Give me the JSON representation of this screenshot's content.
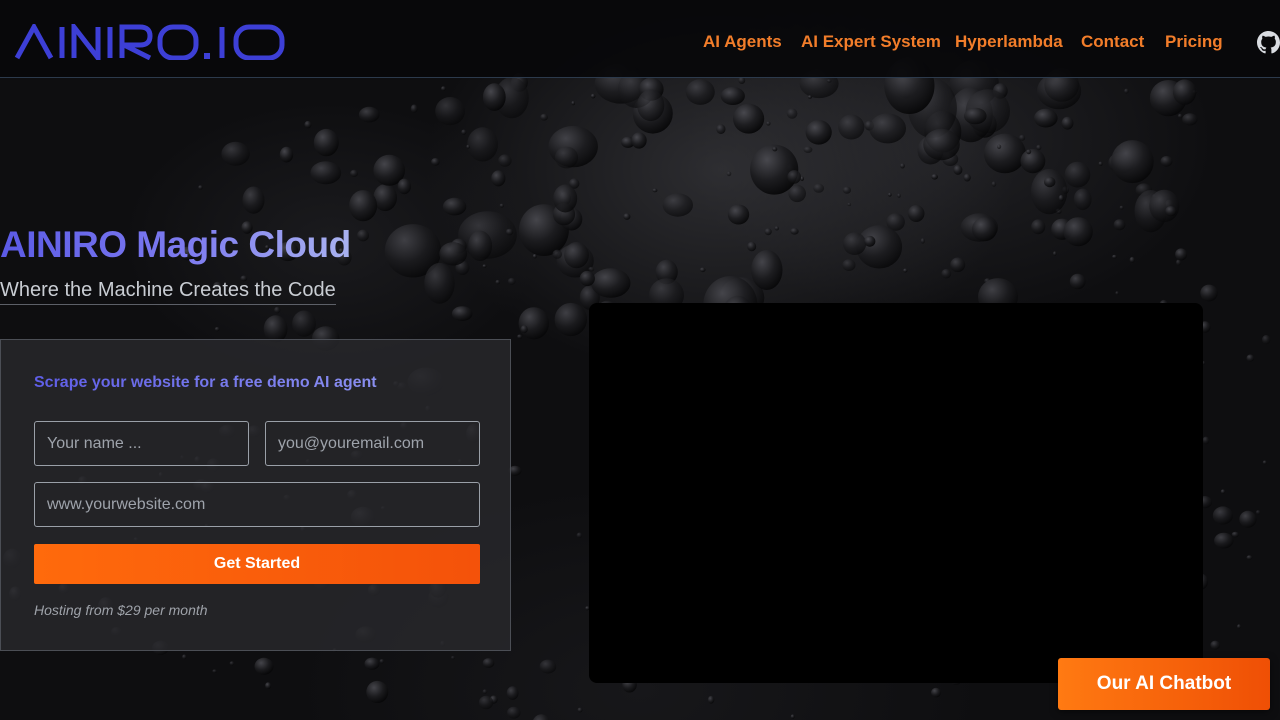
{
  "header": {
    "logo_text": "AINIRO.IO",
    "nav": [
      {
        "label": "AI Agents"
      },
      {
        "label": "AI Expert System"
      },
      {
        "label": "Hyperlambda"
      },
      {
        "label": "Contact"
      },
      {
        "label": "Pricing"
      }
    ],
    "github_icon": "github-icon"
  },
  "hero": {
    "title": "AINIRO Magic Cloud",
    "subtitle": "Where the Machine Creates the Code"
  },
  "form": {
    "title": "Scrape your website for a free demo AI agent",
    "name_placeholder": "Your name ...",
    "email_placeholder": "you@youremail.com",
    "website_placeholder": "www.yourwebsite.com",
    "submit_label": "Get Started",
    "hosting_note": "Hosting from $29 per month"
  },
  "chatbot": {
    "label": "Our AI Chatbot"
  },
  "colors": {
    "accent_orange": "#f27d2a",
    "brand_blue": "#3d3fd6",
    "button_orange": "#ff6a0c"
  }
}
